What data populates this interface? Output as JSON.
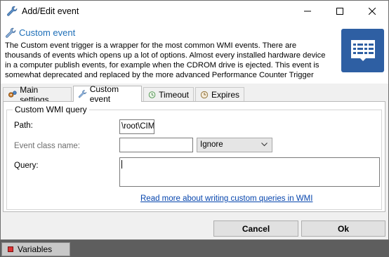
{
  "window": {
    "title": "Add/Edit event"
  },
  "header": {
    "title": "Custom event",
    "description": "The Custom event trigger is a wrapper for the most common WMI events. There are thousands of events which opens up a lot of options. Almost every installed hardware device in a computer publish events, for example when the CDROM drive is ejected. This event is somewhat deprecated and replaced by the more advanced Performance Counter Trigger",
    "big_icon": "document-icon"
  },
  "tabs": [
    {
      "label": "Main settings",
      "icon": "gears-icon"
    },
    {
      "label": "Custom event",
      "icon": "wrench-icon"
    },
    {
      "label": "Timeout",
      "icon": "timeout-icon"
    },
    {
      "label": "Expires",
      "icon": "clock-icon"
    }
  ],
  "active_tab": "Custom event",
  "form": {
    "group_title": "Custom WMI query",
    "path_label": "Path:",
    "path_value": "\\root\\CIM\\",
    "event_class_label": "Event class name:",
    "event_class_value": "",
    "ignore_select": "Ignore",
    "query_label": "Query:",
    "query_value": "",
    "help_link": "Read more about writing custom queries in WMI"
  },
  "buttons": {
    "cancel": "Cancel",
    "ok": "Ok"
  },
  "statusbar": {
    "variables_label": "Variables"
  },
  "colors": {
    "title_accent": "#1e6fb8",
    "big_icon_bg": "#2e5fa3",
    "link": "#0645ad",
    "status_bg": "#5e5e5e"
  }
}
